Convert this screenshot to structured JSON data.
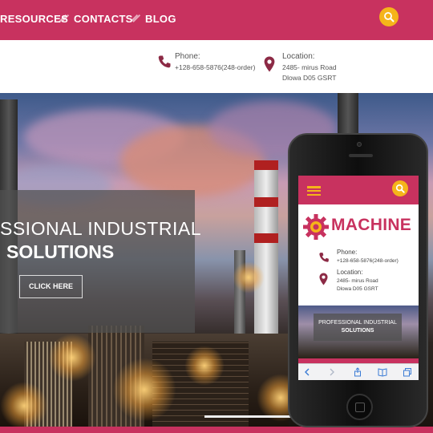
{
  "nav": {
    "items": [
      "RESOURCES",
      "CONTACTS",
      "BLOG"
    ],
    "search_icon": "search-icon"
  },
  "contact": {
    "phone_title": "Phone:",
    "phone_number": "+128-658-5876(248-order)",
    "location_title": "Location:",
    "location_line1": "2485- mirus Road",
    "location_line2": "Dlowa D05 GSRT"
  },
  "hero": {
    "line1": "SSIONAL INDUSTRIAL",
    "line2": "SOLUTIONS",
    "button": "CLICK HERE"
  },
  "mobile": {
    "logo": "MACHINE",
    "phone_title": "Phone:",
    "phone_number": "+128-658-5876(248-order)",
    "location_title": "Location:",
    "location_line1": "2485- mirus Road",
    "location_line2": "Dlowa D05 GSRT",
    "hero_line1": "PROFESSIONAL INDUSTRIAL",
    "hero_line2": "SOLUTIONS"
  },
  "colors": {
    "brand": "#c8325f",
    "accent": "#f5b41a"
  }
}
